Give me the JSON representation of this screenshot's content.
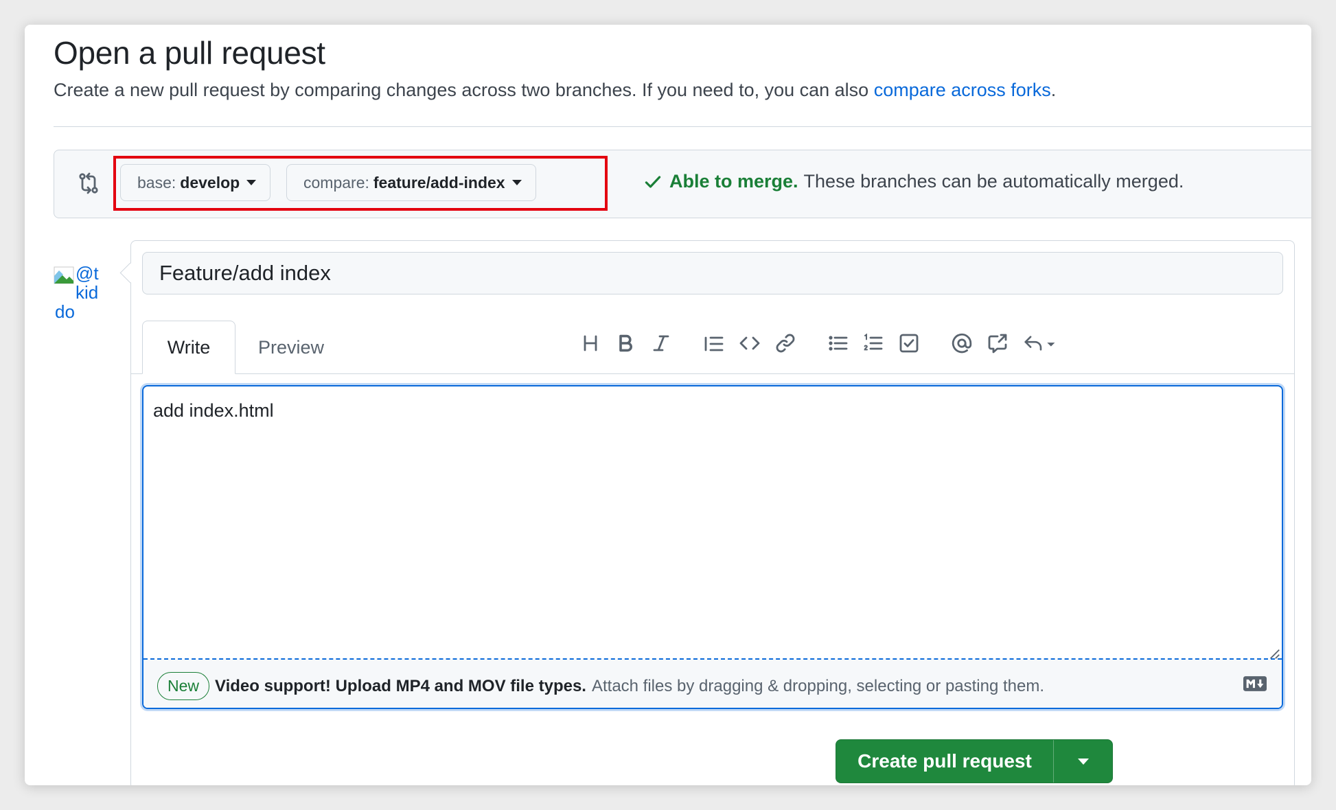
{
  "page": {
    "title": "Open a pull request",
    "subtitle": "Create a new pull request by comparing changes across two branches. If you need to, you can also ",
    "subtitle_link": "compare across forks",
    "subtitle_end": "."
  },
  "range": {
    "base_prefix": "base:",
    "base_branch": "develop",
    "compare_prefix": "compare:",
    "compare_branch": "feature/add-index",
    "status_ok": "Able to merge.",
    "status_text": "These branches can be automatically merged."
  },
  "avatar": {
    "alt_lines": [
      "@t",
      "kid",
      "do"
    ]
  },
  "composer": {
    "title_value": "Feature/add index",
    "tabs": [
      {
        "label": "Write"
      },
      {
        "label": "Preview"
      }
    ],
    "toolbar_icons": [
      "heading-icon",
      "bold-icon",
      "italic-icon",
      "quote-icon",
      "code-icon",
      "link-icon",
      "unordered-list-icon",
      "ordered-list-icon",
      "task-list-icon",
      "mention-icon",
      "reference-icon",
      "saved-replies-icon"
    ],
    "body_value": "add index.html",
    "footer_badge": "New",
    "footer_bold": "Video support! Upload MP4 and MOV file types.",
    "footer_text": "Attach files by dragging & dropping, selecting or pasting them."
  },
  "actions": {
    "create_label": "Create pull request"
  },
  "colors": {
    "accent": "#0969da",
    "success": "#1a7f37",
    "primary_button": "#1f883d",
    "highlight": "#e3000f"
  }
}
